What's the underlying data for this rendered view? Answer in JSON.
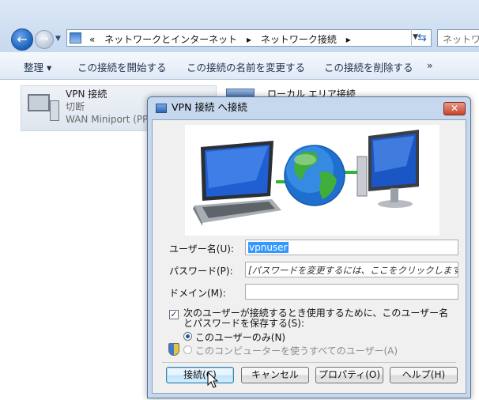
{
  "explorer": {
    "breadcrumb": {
      "prefix": "«",
      "items": [
        "ネットワークとインターネット",
        "ネットワーク接続"
      ],
      "separator": "▸"
    },
    "search_placeholder": "ネットワ"
  },
  "commandbar": {
    "organize": "整理 ▾",
    "start": "この接続を開始する",
    "rename": "この接続の名前を変更する",
    "delete": "この接続を削除する",
    "more": "»"
  },
  "connections": [
    {
      "name": "VPN 接続",
      "status": "切断",
      "device": "WAN Miniport (PP"
    },
    {
      "name": "ローカル エリア接続"
    }
  ],
  "dialog": {
    "title": "VPN 接続 へ接続",
    "close": "✕",
    "username_label": "ユーザー名(U):",
    "username_value": "vpnuser",
    "password_label": "パスワード(P):",
    "password_hint": "[パスワードを変更するには、ここをクリックします]",
    "domain_label": "ドメイン(M):",
    "domain_value": "",
    "save_label": "次のユーザーが接続するとき使用するために、このユーザー名とパスワードを保存する(S):",
    "option_me": "このユーザーのみ(N)",
    "option_all": "このコンピューターを使うすべてのユーザー(A)",
    "buttons": {
      "connect": "接続(C)",
      "cancel": "キャンセル",
      "properties": "プロパティ(O)",
      "help": "ヘルプ(H)"
    }
  }
}
